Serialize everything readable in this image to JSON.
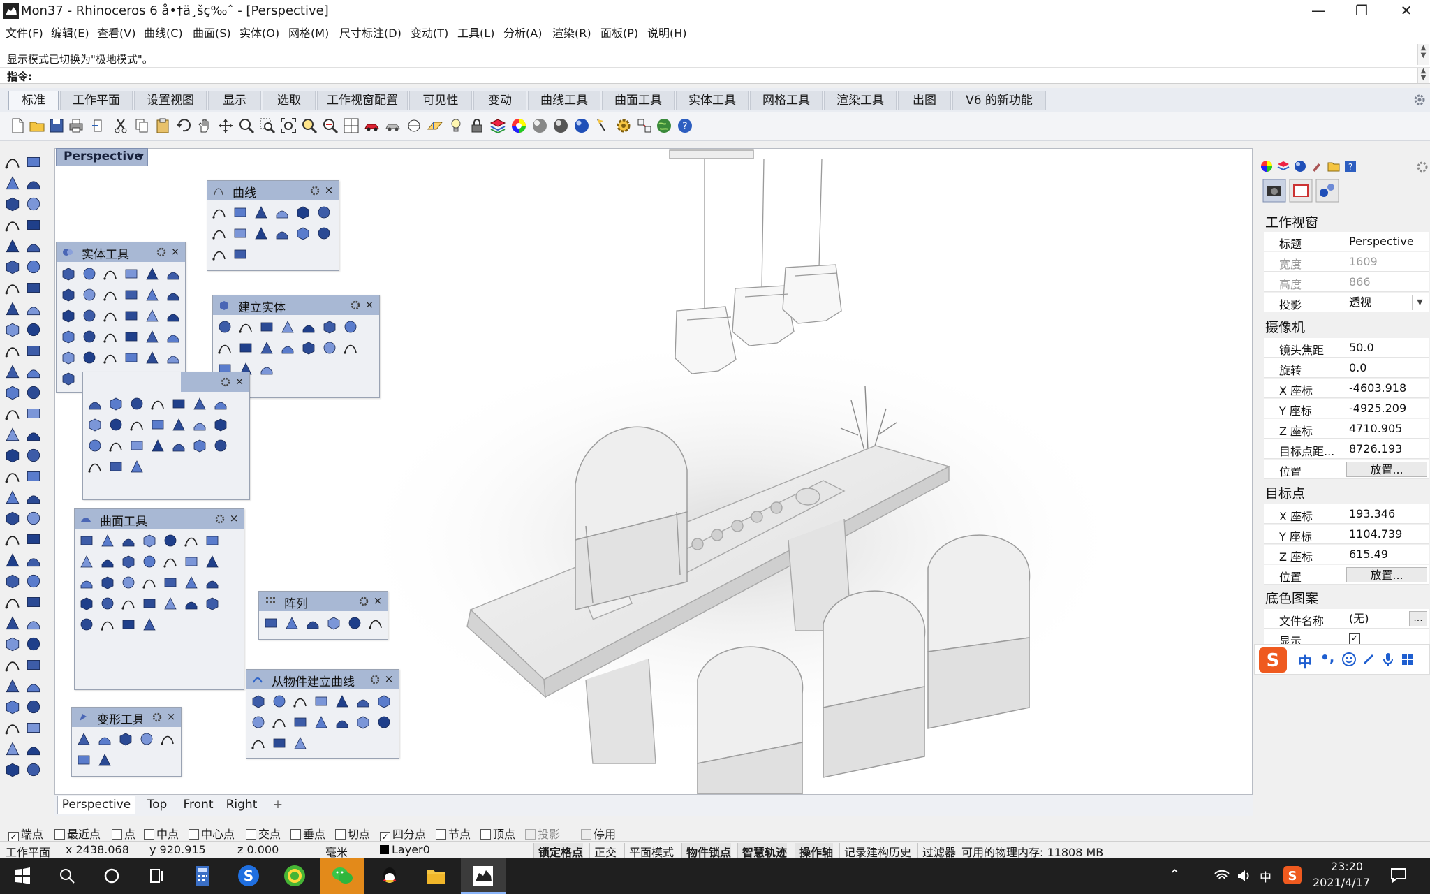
{
  "window": {
    "title": "Mon37 - Rhinoceros 6 å•†ä¸šç‰ˆ - [Perspective]",
    "controls": {
      "minimize": "—",
      "maximize": "❐",
      "close": "✕"
    }
  },
  "menu": [
    "文件(F)",
    "编辑(E)",
    "查看(V)",
    "曲线(C)",
    "曲面(S)",
    "实体(O)",
    "网格(M)",
    "尺寸标注(D)",
    "变动(T)",
    "工具(L)",
    "分析(A)",
    "渲染(R)",
    "面板(P)",
    "说明(H)"
  ],
  "command": {
    "history": "显示模式已切换为\"极地模式\"。",
    "prompt_label": "指令:",
    "prompt_value": ""
  },
  "tabs": [
    "标准",
    "工作平面",
    "设置视图",
    "显示",
    "选取",
    "工作视窗配置",
    "可见性",
    "变动",
    "曲线工具",
    "曲面工具",
    "实体工具",
    "网格工具",
    "渲染工具",
    "出图",
    "V6 的新功能"
  ],
  "active_tab": "标准",
  "viewport": {
    "title": "Perspective",
    "tabs": [
      "Perspective",
      "Top",
      "Front",
      "Right"
    ],
    "add_tab": "+"
  },
  "floating_toolbars": {
    "curve": "曲线",
    "solid_tools": "实体工具",
    "create_solid": "建立实体",
    "surface_tools": "曲面工具",
    "array": "阵列",
    "from_objects": "从物件建立曲线",
    "transform": "变形工具"
  },
  "osnaps": [
    {
      "label": "端点",
      "checked": true,
      "enabled": true
    },
    {
      "label": "最近点",
      "checked": false,
      "enabled": true
    },
    {
      "label": "点",
      "checked": false,
      "enabled": true
    },
    {
      "label": "中点",
      "checked": false,
      "enabled": true
    },
    {
      "label": "中心点",
      "checked": false,
      "enabled": true
    },
    {
      "label": "交点",
      "checked": false,
      "enabled": true
    },
    {
      "label": "垂点",
      "checked": false,
      "enabled": true
    },
    {
      "label": "切点",
      "checked": false,
      "enabled": true
    },
    {
      "label": "四分点",
      "checked": true,
      "enabled": true
    },
    {
      "label": "节点",
      "checked": false,
      "enabled": true
    },
    {
      "label": "顶点",
      "checked": false,
      "enabled": true
    },
    {
      "label": "投影",
      "checked": false,
      "enabled": false
    },
    {
      "label": "停用",
      "checked": false,
      "enabled": false
    }
  ],
  "status": {
    "cplane": "工作平面",
    "x": "x 2438.068",
    "y": "y 920.915",
    "z": "z 0.000",
    "units": "毫米",
    "layer": "Layer0",
    "grid_snap": "锁定格点",
    "ortho": "正交",
    "planar": "平面模式",
    "osnap": "物件锁点",
    "smarttrack": "智慧轨迹",
    "gumball": "操作轴",
    "history": "记录建构历史",
    "filter": "过滤器",
    "memory": "可用的物理内存: 11808 MB"
  },
  "properties": {
    "section_viewport": "工作视窗",
    "title_label": "标题",
    "title_value": "Perspective",
    "width_label": "宽度",
    "width_value": "1609",
    "height_label": "高度",
    "height_value": "866",
    "projection_label": "投影",
    "projection_value": "透视",
    "section_camera": "摄像机",
    "lens_label": "镜头焦距",
    "lens_value": "50.0",
    "rotation_label": "旋转",
    "rotation_value": "0.0",
    "cam_x_label": "X 座标",
    "cam_x_value": "-4603.918",
    "cam_y_label": "Y 座标",
    "cam_y_value": "-4925.209",
    "cam_z_label": "Z 座标",
    "cam_z_value": "4710.905",
    "target_dist_label": "目标点距...",
    "target_dist_value": "8726.193",
    "cam_pos_label": "位置",
    "cam_pos_button": "放置...",
    "section_target": "目标点",
    "tgt_x_label": "X 座标",
    "tgt_x_value": "193.346",
    "tgt_y_label": "Y 座标",
    "tgt_y_value": "1104.739",
    "tgt_z_label": "Z 座标",
    "tgt_z_value": "615.49",
    "tgt_pos_label": "位置",
    "tgt_pos_button": "放置...",
    "section_wallpaper": "底色图案",
    "filename_label": "文件名称",
    "filename_value": "(无)",
    "filename_button": "...",
    "show_label": "显示",
    "show_checked": "✓"
  },
  "ime": {
    "lang": "中",
    "punct": "•,"
  },
  "taskbar": {
    "time": "23:20",
    "date": "2021/4/17",
    "ime_lang": "中"
  },
  "colors": {
    "accent_blue": "#3a5aa8",
    "panel_header": "#a8b8d4",
    "viewport_title": "#a7b6d2"
  }
}
